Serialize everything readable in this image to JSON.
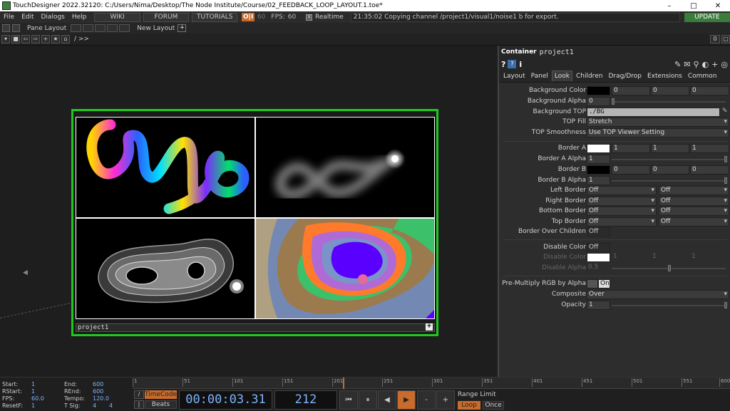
{
  "titlebar": {
    "title": "TouchDesigner 2022.32120: C:/Users/Nima/Desktop/The Node Institute/Course/02_FEEDBACK_LOOP_LAYOUT.1.toe*",
    "min": "–",
    "max": "□",
    "close": "✕"
  },
  "menubar": {
    "menus": [
      "File",
      "Edit",
      "Dialogs",
      "Help"
    ],
    "wiki": "WIKI",
    "forum": "FORUM",
    "tutorials": "TUTORIALS",
    "oi": "O|I",
    "fps_target": "60",
    "fps_label": "FPS:",
    "fps_value": "60",
    "realtime_check": "X",
    "realtime": "Realtime",
    "status": "21:35:02 Copying channel /project1/visual1/noise1 b for export.",
    "update": "UPDATE"
  },
  "panebar": {
    "pane_layout": "Pane Layout",
    "new_layout": "New Layout",
    "plus": "+"
  },
  "pathbar": {
    "path": "/ >>",
    "right_value": "0"
  },
  "node": {
    "name": "project1",
    "plus": "+"
  },
  "params": {
    "header_type": "Container",
    "header_name": "project1",
    "tabs": [
      "Layout",
      "Panel",
      "Look",
      "Children",
      "Drag/Drop",
      "Extensions",
      "Common"
    ],
    "active_tab": "Look",
    "background_color": {
      "label": "Background Color",
      "v1": "0",
      "v2": "0",
      "v3": "0",
      "swatch": "#000000"
    },
    "background_alpha": {
      "label": "Background Alpha",
      "value": "0"
    },
    "background_top": {
      "label": "Background TOP",
      "value": "./BG"
    },
    "top_fill": {
      "label": "TOP Fill",
      "value": "Stretch"
    },
    "top_smoothness": {
      "label": "TOP Smoothness",
      "value": "Use TOP Viewer Setting"
    },
    "border_a": {
      "label": "Border A",
      "v1": "1",
      "v2": "1",
      "v3": "1",
      "swatch": "#ffffff"
    },
    "border_a_alpha": {
      "label": "Border A Alpha",
      "value": "1"
    },
    "border_b": {
      "label": "Border B",
      "v1": "0",
      "v2": "0",
      "v3": "0",
      "swatch": "#000000"
    },
    "border_b_alpha": {
      "label": "Border B Alpha",
      "value": "1"
    },
    "left_border": {
      "label": "Left Border",
      "a": "Off",
      "b": "Off"
    },
    "right_border": {
      "label": "Right Border",
      "a": "Off",
      "b": "Off"
    },
    "bottom_border": {
      "label": "Bottom Border",
      "a": "Off",
      "b": "Off"
    },
    "top_border": {
      "label": "Top Border",
      "a": "Off",
      "b": "Off"
    },
    "border_over_children": {
      "label": "Border Over Children",
      "value": "Off"
    },
    "disable_color_toggle": {
      "label": "Disable Color",
      "value": "Off"
    },
    "disable_color": {
      "label": "Disable Color",
      "v1": "1",
      "v2": "1",
      "v3": "1",
      "swatch": "#ffffff"
    },
    "disable_alpha": {
      "label": "Disable Alpha",
      "value": "0.5"
    },
    "premultiply": {
      "label": "Pre-Multiply RGB by Alpha",
      "value": "On"
    },
    "composite": {
      "label": "Composite",
      "value": "Over"
    },
    "opacity": {
      "label": "Opacity",
      "value": "1"
    }
  },
  "timeline": {
    "start_label": "Start:",
    "start": "1",
    "end_label": "End:",
    "end": "600",
    "rstart_label": "RStart:",
    "rstart": "1",
    "rend_label": "REnd:",
    "rend": "600",
    "fps_label": "FPS:",
    "fps": "60.0",
    "tempo_label": "Tempo:",
    "tempo": "120.0",
    "resetf_label": "ResetF:",
    "resetf": "1",
    "tsig_label": "T Sig:",
    "tsig_a": "4",
    "tsig_b": "4",
    "ruler_ticks": [
      "1",
      "51",
      "101",
      "151",
      "201",
      "251",
      "301",
      "351",
      "401",
      "451",
      "501",
      "551",
      "600"
    ],
    "timecode_btn": "TimeCode",
    "beats_btn": "Beats",
    "timecode": "00:00:03.31",
    "frame": "212",
    "range_limit": "Range Limit",
    "loop": "Loop",
    "once": "Once"
  },
  "colors": {
    "accent": "#c86b2d",
    "node_border": "#1ec91e",
    "value_blue": "#7fb3ff"
  }
}
